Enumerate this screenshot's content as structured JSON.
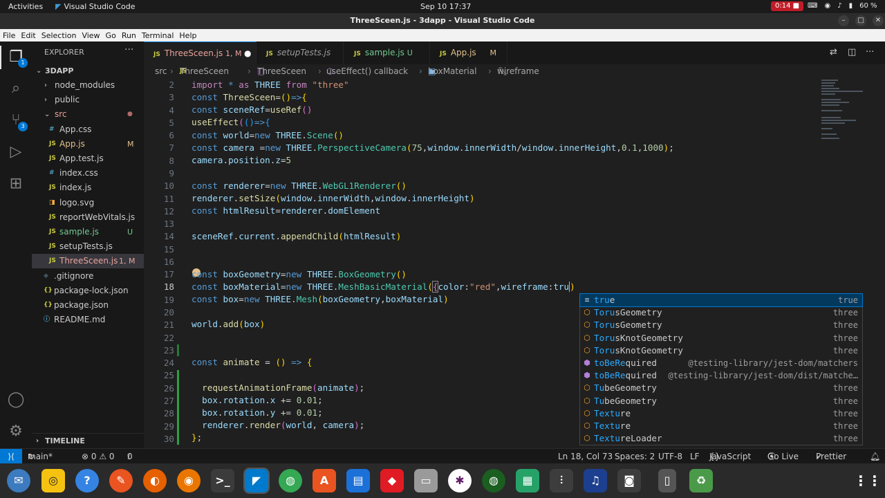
{
  "system": {
    "activities": "Activities",
    "app_name": "Visual Studio Code",
    "clock": "Sep 10  17:37",
    "record_time": "0:14",
    "battery": "60 %"
  },
  "window": {
    "title": "ThreeSceen.js - 3dapp - Visual Studio Code"
  },
  "menu": [
    "File",
    "Edit",
    "Selection",
    "View",
    "Go",
    "Run",
    "Terminal",
    "Help"
  ],
  "activity_bar": {
    "explorer_badge": "1",
    "scm_badge": "3"
  },
  "explorer": {
    "header": "EXPLORER",
    "more": "···",
    "project": "3DAPP",
    "timeline": "TIMELINE",
    "items": [
      {
        "name": "node_modules",
        "type": "folder",
        "badge": ""
      },
      {
        "name": "public",
        "type": "folder",
        "badge": ""
      },
      {
        "name": "src",
        "type": "folder-open",
        "badge": ""
      },
      {
        "name": "App.css",
        "type": "css",
        "badge": ""
      },
      {
        "name": "App.js",
        "type": "js",
        "badge": "M"
      },
      {
        "name": "App.test.js",
        "type": "js",
        "badge": ""
      },
      {
        "name": "index.css",
        "type": "css",
        "badge": ""
      },
      {
        "name": "index.js",
        "type": "js",
        "badge": ""
      },
      {
        "name": "logo.svg",
        "type": "svg",
        "badge": ""
      },
      {
        "name": "reportWebVitals.js",
        "type": "js",
        "badge": ""
      },
      {
        "name": "sample.js",
        "type": "js",
        "badge": "U"
      },
      {
        "name": "setupTests.js",
        "type": "js",
        "badge": ""
      },
      {
        "name": "ThreeSceen.js",
        "type": "js",
        "badge": "1, M"
      },
      {
        "name": ".gitignore",
        "type": "git",
        "badge": ""
      },
      {
        "name": "package-lock.json",
        "type": "json",
        "badge": ""
      },
      {
        "name": "package.json",
        "type": "json",
        "badge": ""
      },
      {
        "name": "README.md",
        "type": "md",
        "badge": ""
      }
    ]
  },
  "tabs": [
    {
      "label": "ThreeSceen.js",
      "status": "1, M",
      "active": true
    },
    {
      "label": "setupTests.js",
      "status": "",
      "active": false
    },
    {
      "label": "sample.js",
      "status": "U",
      "active": false
    },
    {
      "label": "App.js",
      "status": "M",
      "active": false
    }
  ],
  "breadcrumb": [
    "src",
    "ThreeSceen",
    "useEffect() callback",
    "boxMaterial",
    "wireframe"
  ],
  "editor": {
    "line_numbers": [
      "2",
      "3",
      "4",
      "5",
      "6",
      "7",
      "8",
      "9",
      "10",
      "11",
      "12",
      "13",
      "14",
      "15",
      "16",
      "17",
      "18",
      "19",
      "20",
      "21",
      "22",
      "23",
      "24",
      "25",
      "26",
      "27",
      "28",
      "29",
      "30"
    ],
    "current_line": "18"
  },
  "suggestions": [
    {
      "match": "tru",
      "rest": "e",
      "detail": "true",
      "kind": "keyword"
    },
    {
      "match": "Toru",
      "rest": "sGeometry",
      "detail": "three",
      "kind": "class"
    },
    {
      "match": "Toru",
      "rest": "sGeometry",
      "detail": "three",
      "kind": "class"
    },
    {
      "match": "Toru",
      "rest": "sKnotGeometry",
      "detail": "three",
      "kind": "class"
    },
    {
      "match": "Toru",
      "rest": "sKnotGeometry",
      "detail": "three",
      "kind": "class"
    },
    {
      "match": "toBeRe",
      "rest": "quired",
      "detail": "@testing-library/jest-dom/matchers",
      "kind": "method"
    },
    {
      "match": "toBeRe",
      "rest": "quired",
      "detail": "@testing-library/jest-dom/dist/matche…",
      "kind": "method"
    },
    {
      "match": "Tu",
      "rest": "beGeometry",
      "detail": "three",
      "kind": "class"
    },
    {
      "match": "Tu",
      "rest": "beGeometry",
      "detail": "three",
      "kind": "class"
    },
    {
      "match": "Textu",
      "rest": "re",
      "detail": "three",
      "kind": "class"
    },
    {
      "match": "Textu",
      "rest": "re",
      "detail": "three",
      "kind": "class"
    },
    {
      "match": "Textu",
      "rest": "reLoader",
      "detail": "three",
      "kind": "class"
    }
  ],
  "status": {
    "branch": "main*",
    "problems": "⊗ 0 ⚠ 0",
    "ports": "0",
    "position": "Ln 18, Col 73",
    "spaces": "Spaces: 2",
    "encoding": "UTF-8",
    "eol": "LF",
    "language": "JavaScript",
    "golive": "Go Live",
    "prettier": "Prettier"
  }
}
